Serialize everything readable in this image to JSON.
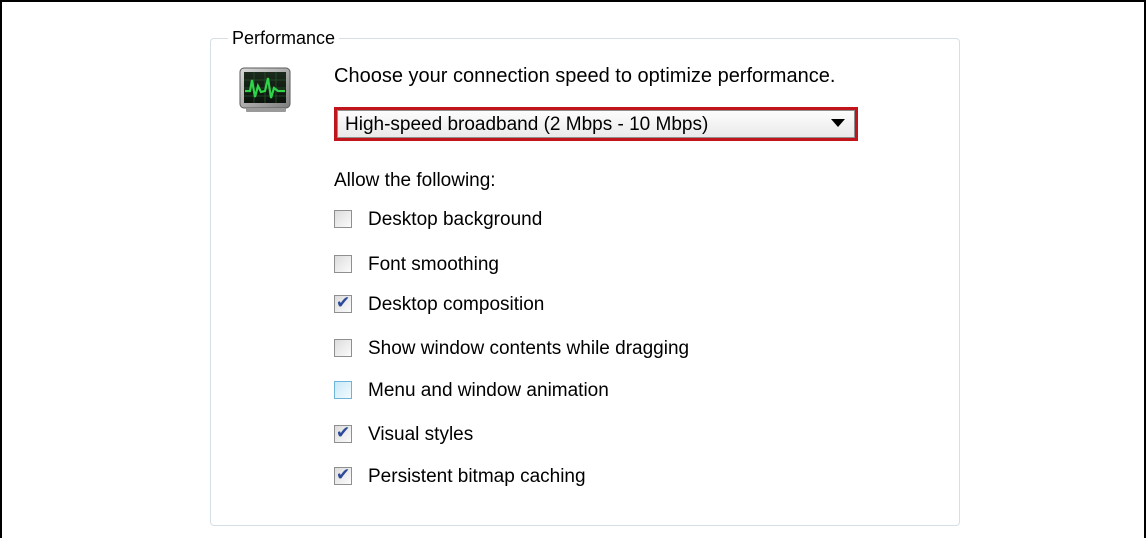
{
  "group": {
    "title": "Performance"
  },
  "connection": {
    "prompt": "Choose your connection speed to optimize performance.",
    "selected": "High-speed broadband (2 Mbps - 10 Mbps)"
  },
  "allow_label": "Allow the following:",
  "options": [
    {
      "label": "Desktop background",
      "checked": false
    },
    {
      "label": "Font smoothing",
      "checked": false
    },
    {
      "label": "Desktop composition",
      "checked": true
    },
    {
      "label": "Show window contents while dragging",
      "checked": false
    },
    {
      "label": "Menu and window animation",
      "checked": false,
      "hovered": true
    },
    {
      "label": "Visual styles",
      "checked": true
    },
    {
      "label": "Persistent bitmap caching",
      "checked": true
    }
  ],
  "colors": {
    "highlight_border": "#c1141b",
    "checkmark": "#2c4a9a",
    "monitor_wave": "#2fd34a"
  }
}
